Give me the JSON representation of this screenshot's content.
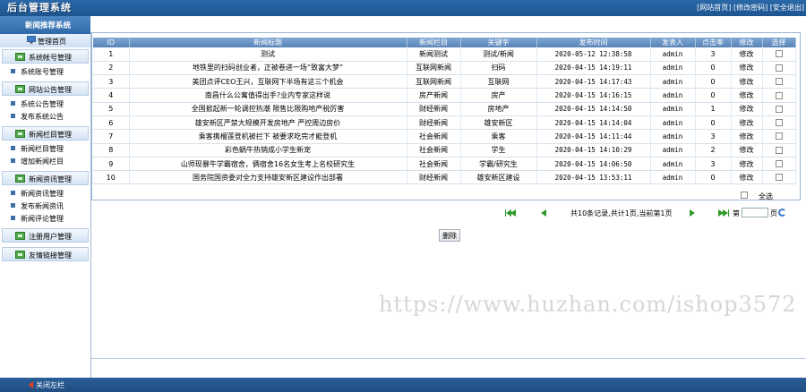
{
  "header": {
    "logo": "后台管理系统",
    "links": [
      "[网站首页]",
      "[修改密码]",
      "[安全退出]"
    ]
  },
  "sidebar": {
    "system_title": "新闻推荐系统",
    "home": "管理首页",
    "groups": [
      {
        "label": "系统帐号管理",
        "items": [
          "系统账号管理"
        ]
      },
      {
        "label": "网站公告管理",
        "items": [
          "系统公告管理",
          "发布系统公告"
        ]
      },
      {
        "label": "新闻栏目管理",
        "items": [
          "新闻栏目管理",
          "增加新闻栏目"
        ]
      },
      {
        "label": "新闻资讯管理",
        "items": [
          "新闻资讯管理",
          "发布新闻资讯",
          "新闻评论管理"
        ]
      },
      {
        "label": "注册用户管理",
        "items": []
      },
      {
        "label": "友情链接管理",
        "items": []
      }
    ]
  },
  "table": {
    "headers": [
      "ID",
      "新闻标题",
      "新闻栏目",
      "关键字",
      "发布时间",
      "发表人",
      "点击率",
      "修改",
      "选择"
    ],
    "rows": [
      {
        "id": "1",
        "title": "测试",
        "column": "新闻测试",
        "keywords": "测试/新闻",
        "time": "2020-05-12 12:38:58",
        "author": "admin",
        "clicks": "3",
        "edit": "修改"
      },
      {
        "id": "2",
        "title": "地铁里的扫码创业者，正被卷进一场“致富大梦”",
        "column": "互联网新闻",
        "keywords": "扫码",
        "time": "2020-04-15 14:19:11",
        "author": "admin",
        "clicks": "0",
        "edit": "修改"
      },
      {
        "id": "3",
        "title": "美团点评CEO王兴，互联网下半场有这三个机会",
        "column": "互联网新闻",
        "keywords": "互联网",
        "time": "2020-04-15 14:17:43",
        "author": "admin",
        "clicks": "0",
        "edit": "修改"
      },
      {
        "id": "4",
        "title": "南昌什么公寓值得出手?业内专家这样说",
        "column": "房产新闻",
        "keywords": "房产",
        "time": "2020-04-15 14:16:15",
        "author": "admin",
        "clicks": "0",
        "edit": "修改"
      },
      {
        "id": "5",
        "title": "全国掀起新一轮调控热潮 限售比限购地产税厉害",
        "column": "财经新闻",
        "keywords": "房地产",
        "time": "2020-04-15 14:14:50",
        "author": "admin",
        "clicks": "1",
        "edit": "修改"
      },
      {
        "id": "6",
        "title": "雄安新区严禁大规模开发房地产 严控周边房价",
        "column": "财经新闻",
        "keywords": "雄安新区",
        "time": "2020-04-15 14:14:04",
        "author": "admin",
        "clicks": "0",
        "edit": "修改"
      },
      {
        "id": "7",
        "title": "乘客携榴莲登机被拦下 被要求吃完才能登机",
        "column": "社会新闻",
        "keywords": "乘客",
        "time": "2020-04-15 14:11:44",
        "author": "admin",
        "clicks": "3",
        "edit": "修改"
      },
      {
        "id": "8",
        "title": "彩色蜗牛热销成小学生新宠",
        "column": "社会新闻",
        "keywords": "学生",
        "time": "2020-04-15 14:10:29",
        "author": "admin",
        "clicks": "2",
        "edit": "修改"
      },
      {
        "id": "9",
        "title": "山师现暴牛学霸宿舍，俩宿舍16名女生考上名校研究生",
        "column": "社会新闻",
        "keywords": "学霸/研究生",
        "time": "2020-04-15 14:06:50",
        "author": "admin",
        "clicks": "3",
        "edit": "修改"
      },
      {
        "id": "10",
        "title": "国务院国资委对全力支持雄安新区建设作出部署",
        "column": "财经新闻",
        "keywords": "雄安新区建设",
        "time": "2020-04-15 13:53:11",
        "author": "admin",
        "clicks": "0",
        "edit": "修改"
      }
    ],
    "select_all": "全选"
  },
  "pager": {
    "info": "共10条记录,共计1页,当前第1页",
    "di": "第",
    "ye": "页"
  },
  "delete_button": "删除",
  "watermark": "https://www.huzhan.com/ishop3572",
  "footer": {
    "close_sidebar": "关闭左栏"
  }
}
